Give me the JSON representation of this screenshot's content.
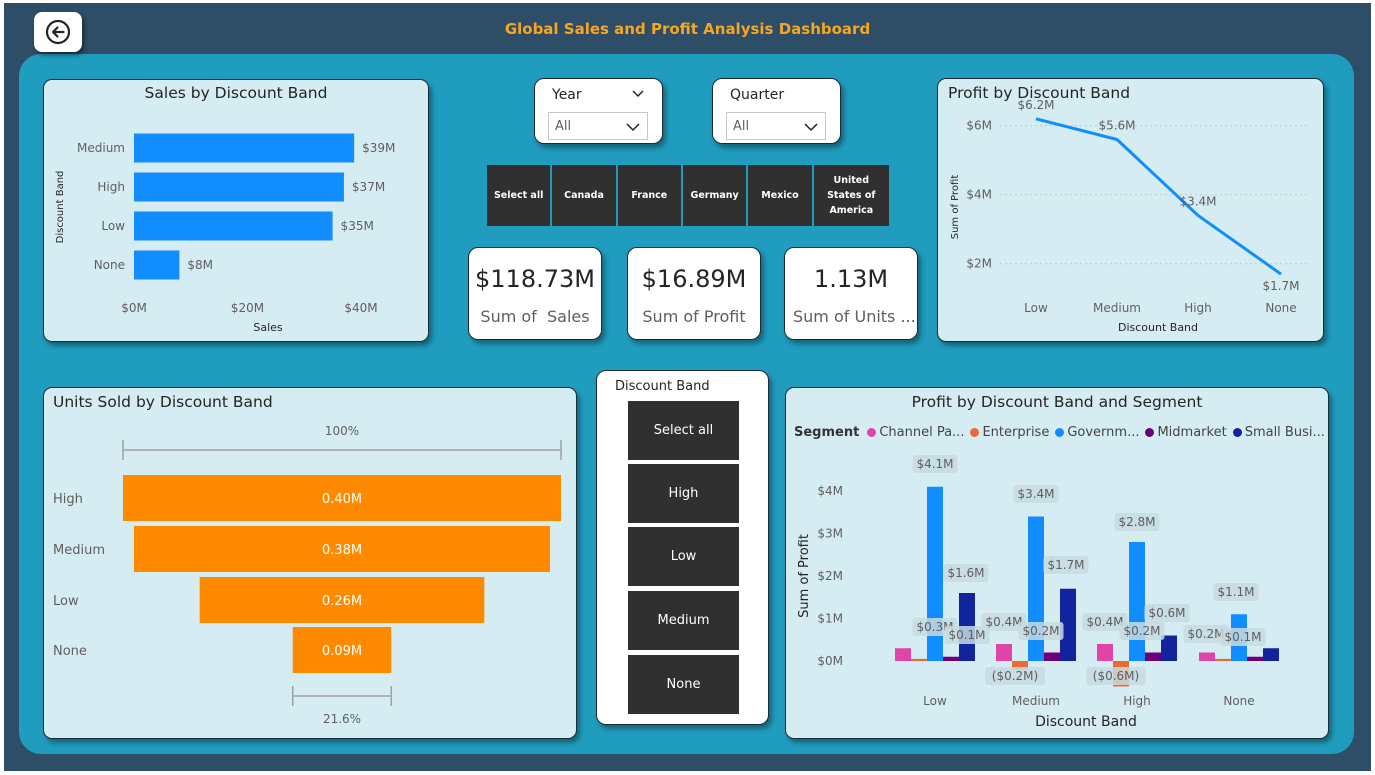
{
  "title": "Global Sales and Profit Analysis Dashboard",
  "colors": {
    "accent_title": "#f5a623",
    "bar_blue": "#118dff",
    "funnel_orange": "#ff8a00",
    "slicer_dark": "#303030"
  },
  "back_icon": "back-arrow-icon",
  "filters": {
    "year": {
      "label": "Year",
      "value": "All"
    },
    "quarter": {
      "label": "Quarter",
      "value": "All"
    }
  },
  "countries": [
    "Select all",
    "Canada",
    "France",
    "Germany",
    "Mexico",
    "United States of America"
  ],
  "kpis": [
    {
      "value": "$118.73M",
      "label": "Sum of  Sales"
    },
    {
      "value": "$16.89M",
      "label": "Sum of Profit"
    },
    {
      "value": "1.13M",
      "label": "Sum of Units ..."
    }
  ],
  "discount_slicer": {
    "title": "Discount Band",
    "options": [
      "Select all",
      "High",
      "Low",
      "Medium",
      "None"
    ]
  },
  "legend": {
    "title": "Segment",
    "items": [
      "Channel Pa...",
      "Enterprise",
      "Governm...",
      "Midmarket",
      "Small Busi..."
    ]
  },
  "chart_data": [
    {
      "id": "sales",
      "type": "bar",
      "orientation": "horizontal",
      "title": "Sales by Discount Band",
      "xlabel": "Sales",
      "ylabel": "Discount Band",
      "categories": [
        "Medium",
        "High",
        "Low",
        "None"
      ],
      "values": [
        38.8,
        37.0,
        35.0,
        8.0
      ],
      "value_labels": [
        "$39M",
        "$37M",
        "$35M",
        "$8M"
      ],
      "x_ticks": [
        0,
        20,
        40
      ],
      "x_tick_labels": [
        "$0M",
        "$20M",
        "$40M"
      ],
      "xlim": [
        0,
        46
      ],
      "grid": false
    },
    {
      "id": "profit_line",
      "type": "line",
      "title": "Profit by Discount Band",
      "xlabel": "Discount Band",
      "ylabel": "Sum of Profit",
      "categories": [
        "Low",
        "Medium",
        "High",
        "None"
      ],
      "values": [
        6.2,
        5.6,
        3.4,
        1.7
      ],
      "value_labels": [
        "$6.2M",
        "$5.6M",
        "$3.4M",
        "$1.7M"
      ],
      "y_ticks": [
        2,
        4,
        6
      ],
      "y_tick_labels": [
        "$2M",
        "$4M",
        "$6M"
      ],
      "ylim": [
        1.5,
        6.6
      ],
      "grid": true
    },
    {
      "id": "units_funnel",
      "type": "funnel",
      "title": "Units Sold by Discount Band",
      "categories": [
        "High",
        "Medium",
        "Low",
        "None"
      ],
      "values": [
        0.4,
        0.38,
        0.26,
        0.09
      ],
      "value_labels": [
        "0.40M",
        "0.38M",
        "0.26M",
        "0.09M"
      ],
      "top_percent_label": "100%",
      "bottom_percent_label": "21.6%"
    },
    {
      "id": "profit_segment",
      "type": "bar",
      "title": "Profit by Discount Band and Segment",
      "xlabel": "Discount Band",
      "ylabel": "Sum of Profit",
      "categories": [
        "Low",
        "Medium",
        "High",
        "None"
      ],
      "series": [
        {
          "name": "Channel Pa...",
          "color": "#e044a7",
          "values": [
            0.3,
            0.4,
            0.4,
            0.2
          ],
          "labels": [
            "$0.3M",
            "$0.4M",
            "$0.4M",
            "$0.2M"
          ]
        },
        {
          "name": "Enterprise",
          "color": "#e66c37",
          "values": [
            0.05,
            -0.2,
            -0.6,
            0.05
          ],
          "labels": [
            "",
            "($0.2M)",
            "($0.6M)",
            ""
          ]
        },
        {
          "name": "Governm...",
          "color": "#118dff",
          "values": [
            4.1,
            3.4,
            2.8,
            1.1
          ],
          "labels": [
            "$4.1M",
            "$3.4M",
            "$2.8M",
            "$1.1M"
          ]
        },
        {
          "name": "Midmarket",
          "color": "#6b007b",
          "values": [
            0.1,
            0.2,
            0.2,
            0.1
          ],
          "labels": [
            "$0.1M",
            "$0.2M",
            "$0.2M",
            "$0.1M"
          ]
        },
        {
          "name": "Small Busi...",
          "color": "#12239e",
          "values": [
            1.6,
            1.7,
            0.6,
            0.3
          ],
          "labels": [
            "$1.6M",
            "$1.7M",
            "$0.6M",
            "$0.1M"
          ]
        }
      ],
      "y_ticks": [
        0,
        1,
        2,
        3,
        4
      ],
      "y_tick_labels": [
        "$0M",
        "$1M",
        "$2M",
        "$3M",
        "$4M"
      ],
      "ylim": [
        -0.65,
        4.5
      ],
      "legend_position": "top-left",
      "grid": false
    }
  ]
}
